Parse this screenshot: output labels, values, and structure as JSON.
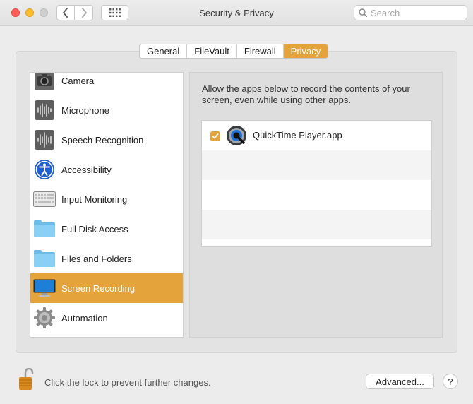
{
  "window": {
    "title": "Security & Privacy"
  },
  "toolbar": {
    "search_placeholder": "Search"
  },
  "tabs": [
    {
      "label": "General",
      "active": false
    },
    {
      "label": "FileVault",
      "active": false
    },
    {
      "label": "Firewall",
      "active": false
    },
    {
      "label": "Privacy",
      "active": true
    }
  ],
  "sidebar": {
    "items": [
      {
        "label": "Camera",
        "icon": "camera-icon",
        "selected": false
      },
      {
        "label": "Microphone",
        "icon": "microphone-icon",
        "selected": false
      },
      {
        "label": "Speech Recognition",
        "icon": "speech-recognition-icon",
        "selected": false
      },
      {
        "label": "Accessibility",
        "icon": "accessibility-icon",
        "selected": false
      },
      {
        "label": "Input Monitoring",
        "icon": "keyboard-icon",
        "selected": false
      },
      {
        "label": "Full Disk Access",
        "icon": "folder-icon",
        "selected": false
      },
      {
        "label": "Files and Folders",
        "icon": "folder-icon",
        "selected": false
      },
      {
        "label": "Screen Recording",
        "icon": "display-icon",
        "selected": true
      },
      {
        "label": "Automation",
        "icon": "gear-icon",
        "selected": false
      }
    ]
  },
  "content": {
    "description": "Allow the apps below to record the contents of your screen, even while using other apps.",
    "apps": [
      {
        "name": "QuickTime Player.app",
        "checked": true,
        "icon": "quicktime-icon"
      }
    ]
  },
  "footer": {
    "lock_text": "Click the lock to prevent further changes.",
    "advanced_label": "Advanced...",
    "help_label": "?"
  },
  "colors": {
    "accent": "#e5a33c",
    "window_bg": "#ececec"
  }
}
